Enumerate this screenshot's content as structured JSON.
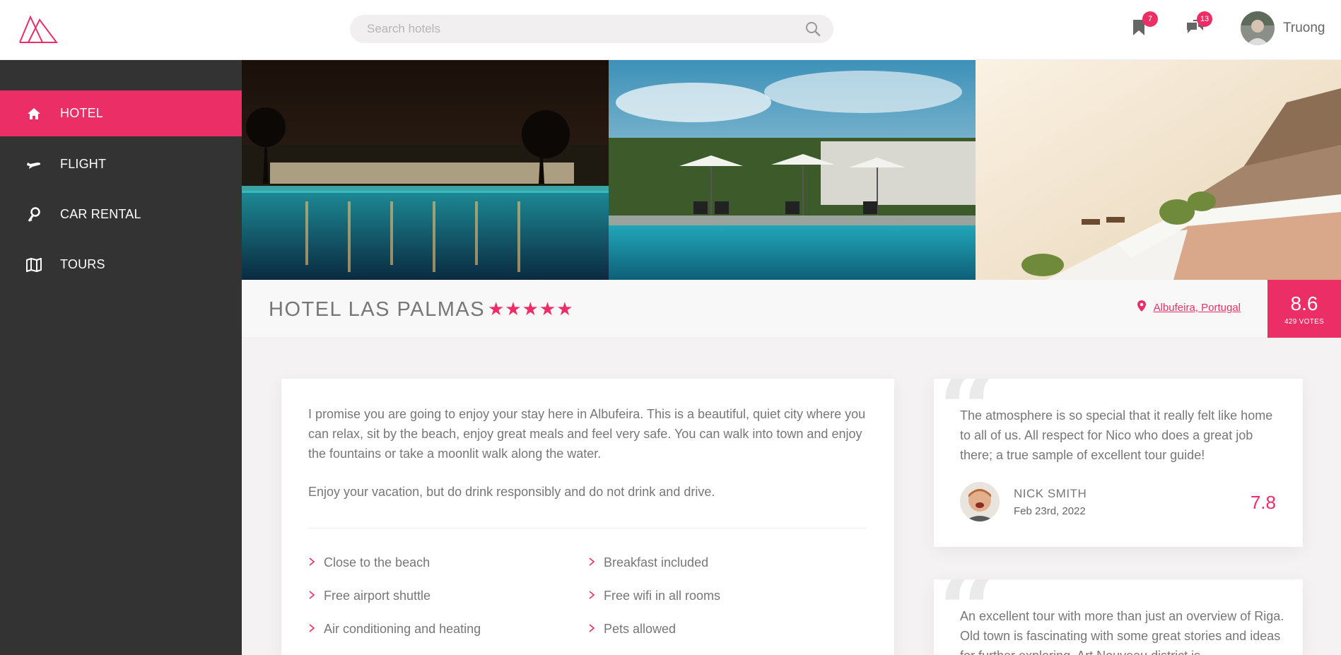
{
  "header": {
    "search_placeholder": "Search hotels",
    "bookmarks_count": "7",
    "messages_count": "13",
    "user_name": "Truong"
  },
  "sidebar": {
    "items": [
      {
        "label": "HOTEL",
        "icon": "home-icon",
        "active": true
      },
      {
        "label": "FLIGHT",
        "icon": "airplane-icon",
        "active": false
      },
      {
        "label": "CAR RENTAL",
        "icon": "key-icon",
        "active": false
      },
      {
        "label": "TOURS",
        "icon": "map-icon",
        "active": false
      }
    ]
  },
  "hotel": {
    "name": "HOTEL LAS PALMAS",
    "stars": "★★★★★",
    "location": "Albufeira, Portugal",
    "score": "8.6",
    "votes": "429 VOTES"
  },
  "description": {
    "paragraph1": "I promise you are going to enjoy your stay here in Albufeira. This is a beautiful, quiet city where you can relax, sit by the beach, enjoy great meals and feel very safe. You can walk into town and enjoy the fountains or take a moonlit walk along the water.",
    "paragraph2": "Enjoy your vacation, but do drink responsibly and do not drink and drive.",
    "amenities": [
      "Close to the beach",
      "Breakfast included",
      "Free airport shuttle",
      "Free wifi in all rooms",
      "Air conditioning and heating",
      "Pets allowed"
    ]
  },
  "reviews": [
    {
      "text": "The atmosphere is so special that it really felt like home to all of us. All respect for Nico who does a great job there; a true sample of excellent tour guide!",
      "name": "NICK SMITH",
      "date": "Feb 23rd, 2022",
      "score": "7.8"
    },
    {
      "text": "An excellent tour with more than just an overview of Riga. Old town is fascinating with some great stories and ideas for further exploring. Art Nouveau district is"
    }
  ],
  "colors": {
    "accent": "#ec2e66",
    "sidebar": "#333333",
    "background": "#f4f2f2"
  }
}
